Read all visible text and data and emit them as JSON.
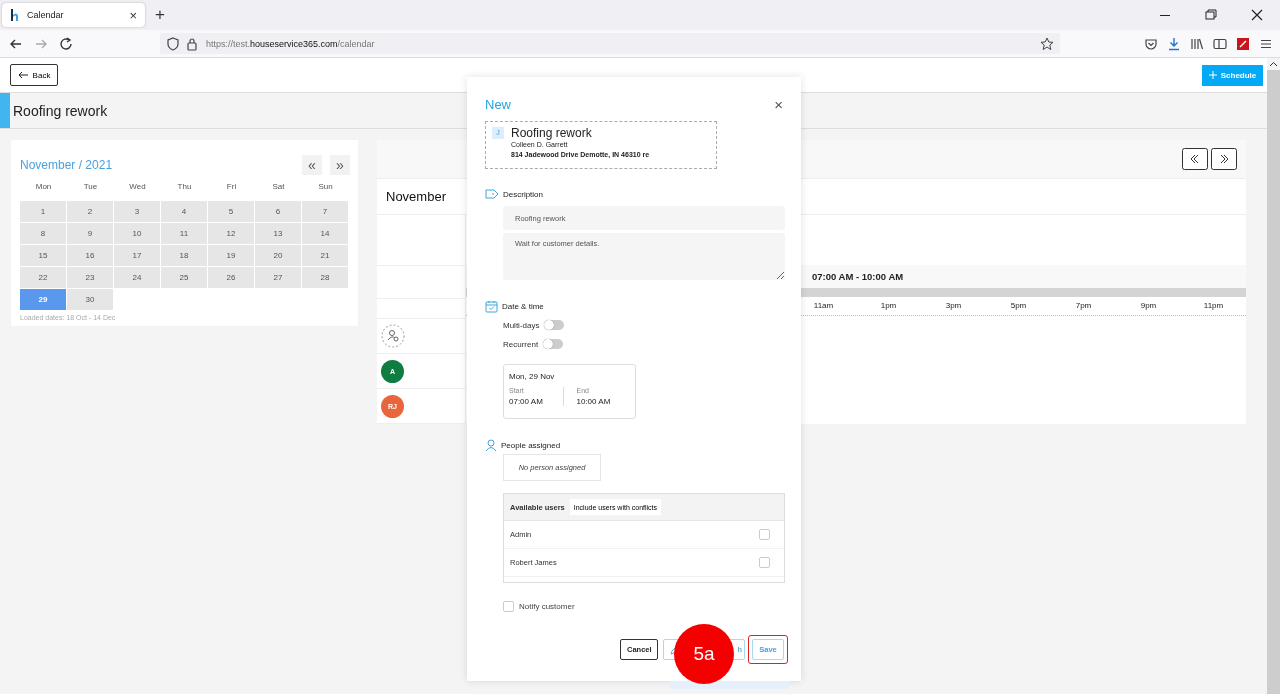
{
  "browser": {
    "tab": {
      "title": "Calendar",
      "close": "×"
    },
    "new_tab": "+",
    "url": {
      "scheme": "https://test.",
      "domain": "houseservice365.com",
      "path": "/calendar"
    }
  },
  "toolbar": {
    "back_button": "Back",
    "schedule_button": "Schedule"
  },
  "page_title": "Roofing rework",
  "mini_calendar": {
    "heading": "November / 2021",
    "prev": "«",
    "next": "»",
    "weekdays": [
      "Mon",
      "Tue",
      "Wed",
      "Thu",
      "Fri",
      "Sat",
      "Sun"
    ],
    "days": [
      {
        "label": "1",
        "selected": false
      },
      {
        "label": "2",
        "selected": false
      },
      {
        "label": "3",
        "selected": false
      },
      {
        "label": "4",
        "selected": false
      },
      {
        "label": "5",
        "selected": false
      },
      {
        "label": "6",
        "selected": false
      },
      {
        "label": "7",
        "selected": false
      },
      {
        "label": "8",
        "selected": false
      },
      {
        "label": "9",
        "selected": false
      },
      {
        "label": "10",
        "selected": false
      },
      {
        "label": "11",
        "selected": false
      },
      {
        "label": "12",
        "selected": false
      },
      {
        "label": "13",
        "selected": false
      },
      {
        "label": "14",
        "selected": false
      },
      {
        "label": "15",
        "selected": false
      },
      {
        "label": "16",
        "selected": false
      },
      {
        "label": "17",
        "selected": false
      },
      {
        "label": "18",
        "selected": false
      },
      {
        "label": "19",
        "selected": false
      },
      {
        "label": "20",
        "selected": false
      },
      {
        "label": "21",
        "selected": false
      },
      {
        "label": "22",
        "selected": false
      },
      {
        "label": "23",
        "selected": false
      },
      {
        "label": "24",
        "selected": false
      },
      {
        "label": "25",
        "selected": false
      },
      {
        "label": "26",
        "selected": false
      },
      {
        "label": "27",
        "selected": false
      },
      {
        "label": "28",
        "selected": false
      },
      {
        "label": "29",
        "selected": true
      },
      {
        "label": "30",
        "selected": false
      }
    ],
    "loaded_dates": "Loaded dates: 18 Oct - 14 Dec"
  },
  "schedule": {
    "month": "November",
    "time_range": "07:00 AM - 10:00 AM",
    "hours": [
      "11am",
      "1pm",
      "3pm",
      "5pm",
      "7pm",
      "9pm",
      "11pm"
    ],
    "people": [
      {
        "kind": "unassigned"
      },
      {
        "kind": "user",
        "initials": "A",
        "color": "#0f7d3f"
      },
      {
        "kind": "user",
        "initials": "RJ",
        "color": "#e9653b"
      }
    ]
  },
  "dialog": {
    "title": "New",
    "close": "×",
    "job": {
      "badge": "J",
      "title": "Roofing rework",
      "customer": "Colleen D. Garrett",
      "address": "814 Jadewood Drive Demotte, IN 46310 re"
    },
    "description": {
      "label": "Description",
      "title_value": "Roofing rework",
      "notes_value": "Wait for customer details."
    },
    "date_time": {
      "label": "Date & time",
      "toggles": [
        {
          "label": "Multi-days",
          "on": false
        },
        {
          "label": "Recurrent",
          "on": false
        }
      ],
      "date": "Mon, 29 Nov",
      "start_label": "Start",
      "start": "07:00 AM",
      "end_label": "End",
      "end": "10:00 AM"
    },
    "people": {
      "label": "People assigned",
      "assigned_placeholder": "No person assigned",
      "available_label": "Available users",
      "conflicts_button": "Include users with conflicts",
      "users": [
        {
          "name": "Admin",
          "checked": false
        },
        {
          "name": "Robert James",
          "checked": false
        }
      ]
    },
    "notify": {
      "label": "Notify customer",
      "checked": false
    },
    "buttons": [
      {
        "kind": "cancel",
        "label": "Cancel",
        "highlighted": false
      },
      {
        "kind": "edit",
        "label": "h",
        "highlighted": false
      },
      {
        "kind": "save",
        "label": "Save",
        "highlighted": true
      }
    ]
  },
  "annotation": {
    "label": "5a"
  }
}
